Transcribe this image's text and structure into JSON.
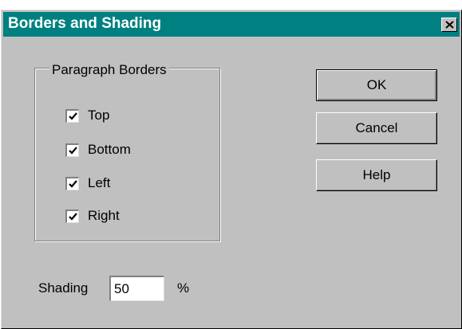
{
  "dialog": {
    "title": "Borders and Shading",
    "close_icon": "close-icon"
  },
  "paragraph_borders": {
    "legend": "Paragraph Borders",
    "options": [
      {
        "label": "Top",
        "checked": true
      },
      {
        "label": "Bottom",
        "checked": true
      },
      {
        "label": "Left",
        "checked": true
      },
      {
        "label": "Right",
        "checked": true
      }
    ]
  },
  "buttons": {
    "ok": "OK",
    "cancel": "Cancel",
    "help": "Help"
  },
  "shading": {
    "label": "Shading",
    "value": "50",
    "unit": "%"
  },
  "colors": {
    "title_bar": "#008080",
    "face": "#c0c0c0"
  }
}
